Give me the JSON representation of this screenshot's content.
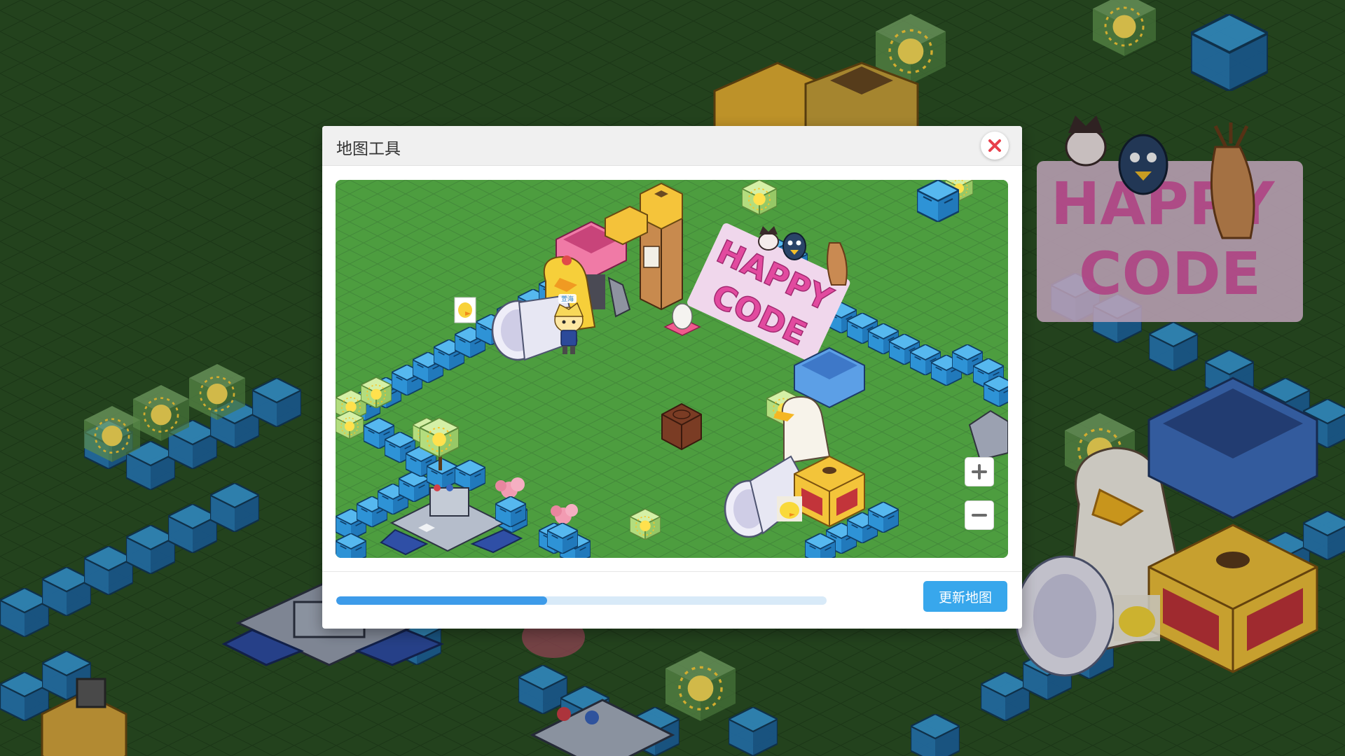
{
  "dialog": {
    "title": "地图工具",
    "update_button": "更新地图",
    "progress": 0.43
  },
  "map": {
    "player_name": "萱海",
    "sign_letters": [
      "H",
      "A",
      "P",
      "P",
      "Y",
      "C",
      "O",
      "D",
      "E"
    ]
  },
  "icons": {
    "close": "close-icon",
    "zoom_in": "plus-icon",
    "zoom_out": "minus-icon"
  },
  "colors": {
    "accent": "#38a7ec",
    "progress_fill": "#3d9be9",
    "progress_track": "#d8eaf8",
    "close_x": "#e8404b",
    "grass": "#4a9a3c",
    "block_blue": "#3aa7e5"
  }
}
